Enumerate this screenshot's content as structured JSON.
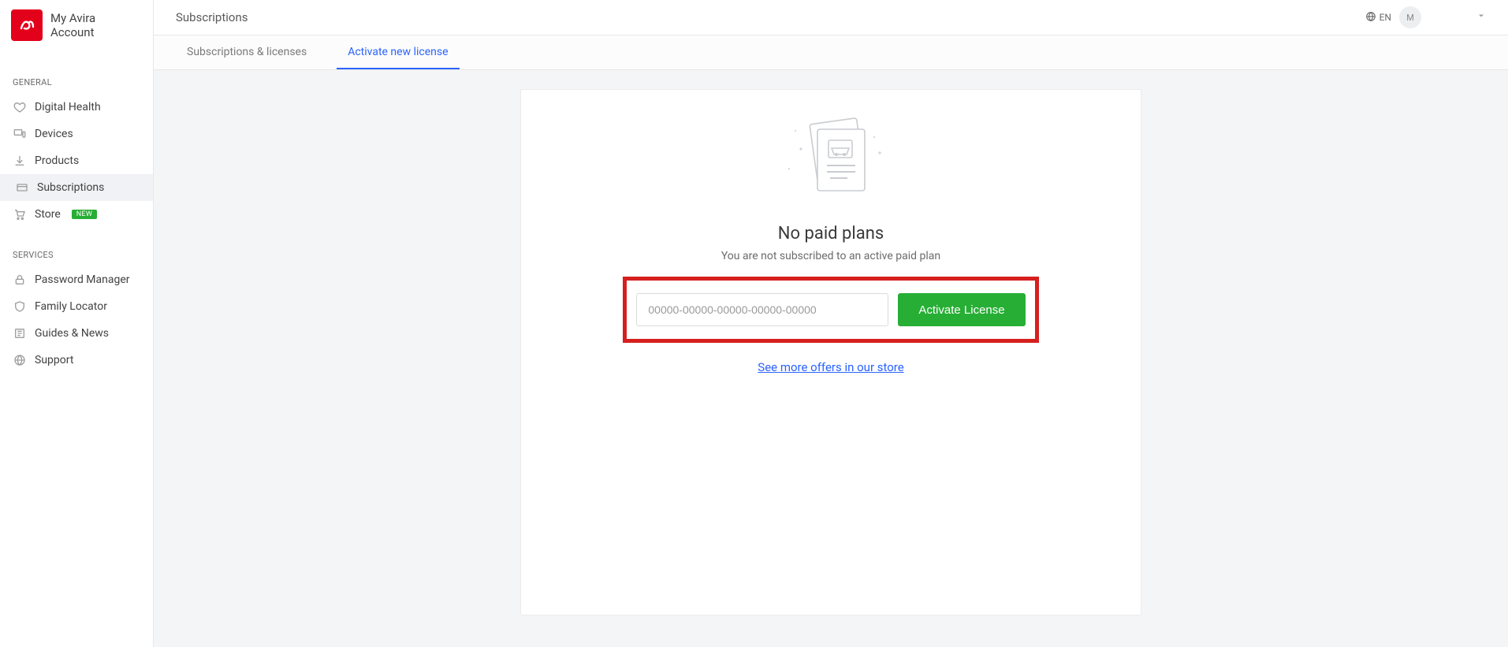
{
  "brand": {
    "line1": "My Avira",
    "line2": "Account"
  },
  "sidebar": {
    "section_general": "GENERAL",
    "section_services": "SERVICES",
    "general": [
      {
        "label": "Digital Health"
      },
      {
        "label": "Devices"
      },
      {
        "label": "Products"
      },
      {
        "label": "Subscriptions"
      },
      {
        "label": "Store"
      }
    ],
    "store_badge": "NEW",
    "services": [
      {
        "label": "Password Manager"
      },
      {
        "label": "Family Locator"
      },
      {
        "label": "Guides & News"
      },
      {
        "label": "Support"
      }
    ]
  },
  "topbar": {
    "title": "Subscriptions",
    "lang_label": "EN",
    "avatar_initial": "M"
  },
  "tabs": {
    "subs_licenses": "Subscriptions & licenses",
    "activate_new": "Activate new license"
  },
  "card": {
    "heading": "No paid plans",
    "subtext": "You are not subscribed to an active paid plan",
    "license_placeholder": "00000-00000-00000-00000-00000",
    "activate_button": "Activate License",
    "more_link": "See more offers in our store"
  }
}
